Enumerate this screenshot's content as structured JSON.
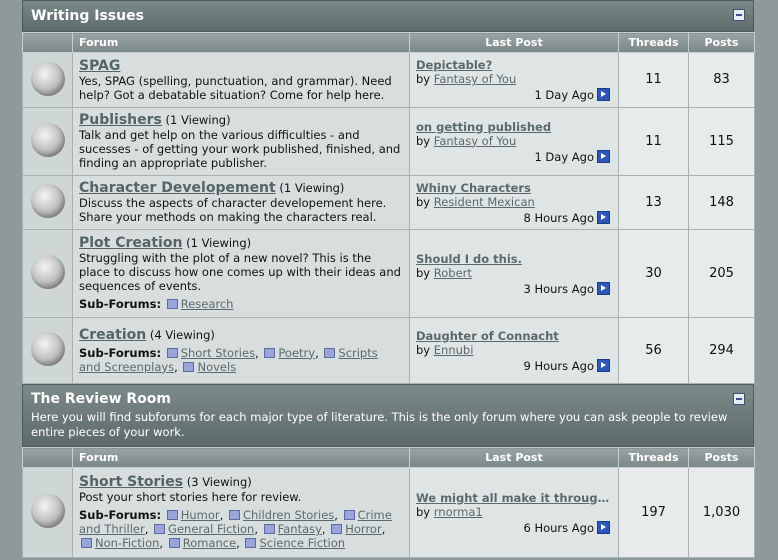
{
  "sections": [
    {
      "title": "Writing Issues",
      "description": "",
      "headers": {
        "forum": "Forum",
        "last_post": "Last Post",
        "threads": "Threads",
        "posts": "Posts"
      },
      "forums": [
        {
          "name": "SPAG",
          "viewing": "",
          "description": "Yes, SPAG (spelling, punctuation, and grammar). Need help? Got a debatable situation? Come for help here.",
          "subforums": [],
          "last_post": {
            "title": "Depictable?",
            "by_label": "by",
            "author": "Fantasy of You",
            "time": "1 Day Ago"
          },
          "threads": "11",
          "posts": "83"
        },
        {
          "name": "Publishers",
          "viewing": "(1 Viewing)",
          "description": "Talk and get help on the various difficulties - and sucesses - of getting your work published, finished, and finding an appropriate publisher.",
          "subforums": [],
          "last_post": {
            "title": "on getting published",
            "by_label": "by",
            "author": "Fantasy of You",
            "time": "1 Day Ago"
          },
          "threads": "11",
          "posts": "115"
        },
        {
          "name": "Character Developement",
          "viewing": "(1 Viewing)",
          "description": "Discuss the aspects of character developement here. Share your methods on making the characters real.",
          "subforums": [],
          "last_post": {
            "title": "Whiny Characters",
            "by_label": "by",
            "author": "Resident Mexican",
            "time": "8 Hours Ago"
          },
          "threads": "13",
          "posts": "148"
        },
        {
          "name": "Plot Creation",
          "viewing": "(1 Viewing)",
          "description": "Struggling with the plot of a new novel? This is the place to discuss how one comes up with their ideas and sequences of events.",
          "subforums_label": "Sub-Forums:",
          "subforums": [
            "Research"
          ],
          "last_post": {
            "title": "Should I do this.",
            "by_label": "by",
            "author": "Robert",
            "time": "3 Hours Ago"
          },
          "threads": "30",
          "posts": "205"
        },
        {
          "name": "Creation",
          "viewing": "(4 Viewing)",
          "description": "",
          "subforums_label": "Sub-Forums:",
          "subforums": [
            "Short Stories",
            "Poetry",
            "Scripts and Screenplays",
            "Novels"
          ],
          "last_post": {
            "title": "Daughter of Connacht",
            "by_label": "by",
            "author": "Ennubi",
            "time": "9 Hours Ago"
          },
          "threads": "56",
          "posts": "294"
        }
      ]
    },
    {
      "title": "The Review Room",
      "description": "Here you will find subforums for each major type of literature. This is the only forum where you can ask people to review entire pieces of your work.",
      "headers": {
        "forum": "Forum",
        "last_post": "Last Post",
        "threads": "Threads",
        "posts": "Posts"
      },
      "forums": [
        {
          "name": "Short Stories",
          "viewing": "(3 Viewing)",
          "description": "Post your short stories here for review.",
          "subforums_label": "Sub-Forums:",
          "subforums": [
            "Humor",
            "Children Stories",
            "Crime and Thriller",
            "General Fiction",
            "Fantasy",
            "Horror",
            "Non-Fiction",
            "Romance",
            "Science Fiction"
          ],
          "last_post": {
            "title": "We might all make it through...",
            "by_label": "by",
            "author": "rnorma1",
            "time": "6 Hours Ago"
          },
          "threads": "197",
          "posts": "1,030"
        }
      ]
    }
  ]
}
